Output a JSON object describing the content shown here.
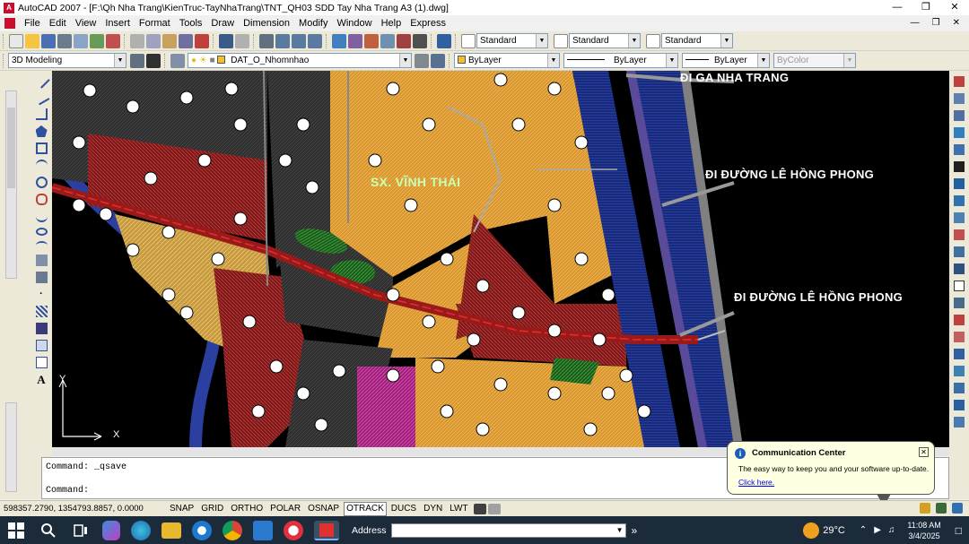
{
  "window": {
    "title": "AutoCAD 2007 - [F:\\Qh Nha Trang\\KienTruc-TayNhaTrang\\TNT_QH03  SDD Tay Nha Trang A3 (1).dwg]",
    "app_badge": "A"
  },
  "menu": [
    "File",
    "Edit",
    "View",
    "Insert",
    "Format",
    "Tools",
    "Draw",
    "Dimension",
    "Modify",
    "Window",
    "Help",
    "Express"
  ],
  "toolbar": {
    "text_style": "Standard",
    "dim_style": "Standard",
    "table_style": "Standard",
    "workspace": "3D Modeling",
    "layer": "DAT_O_Nhomnhao",
    "color": "ByLayer",
    "linetype": "ByLayer",
    "lineweight": "ByLayer",
    "plotstyle": "ByColor"
  },
  "drawing": {
    "annotations": {
      "ga": "ĐI GA NHA TRANG",
      "le_hong_phong_1": "ĐI ĐƯỜNG LÊ HỒNG PHONG",
      "le_hong_phong_2": "ĐI ĐƯỜNG LÊ HỒNG PHONG",
      "vinh_thai": "SX. VĨNH THÁI"
    },
    "ucs": {
      "y": "Y",
      "x": "X"
    }
  },
  "command": {
    "line1": "Command: _qsave",
    "line2": "Command:"
  },
  "status": {
    "coords": "598357.2790, 1354793.8857, 0.0000",
    "buttons": [
      "SNAP",
      "GRID",
      "ORTHO",
      "POLAR",
      "OSNAP",
      "OTRACK",
      "DUCS",
      "DYN",
      "LWT"
    ],
    "active_button": "OTRACK"
  },
  "comm_center": {
    "title": "Communication Center",
    "message": "The easy way to keep you and your software up-to-date.",
    "link": "Click here."
  },
  "taskbar": {
    "address_label": "Address",
    "weather": "29°C",
    "time": "11:08 AM",
    "date": "3/4/2025"
  }
}
